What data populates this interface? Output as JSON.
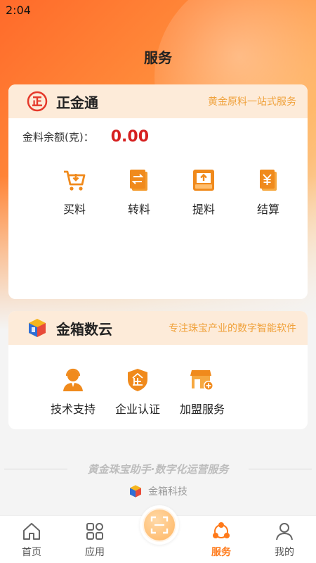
{
  "status_bar": {
    "time": "2:04"
  },
  "page": {
    "title": "服务"
  },
  "card_zhengjintong": {
    "name": "正金通",
    "subtitle": "黄金原料一站式服务",
    "balance_label": "金料余额(克)：",
    "balance_value": "0.00",
    "items": [
      {
        "label": "买料",
        "icon": "shopping-cart-icon"
      },
      {
        "label": "转料",
        "icon": "transfer-icon"
      },
      {
        "label": "提料",
        "icon": "inbox-tray-icon"
      },
      {
        "label": "结算",
        "icon": "yuan-bill-icon"
      }
    ]
  },
  "card_jinxiang": {
    "name": "金箱数云",
    "subtitle": "专注珠宝产业的数字智能软件",
    "items": [
      {
        "label": "技术支持",
        "icon": "support-agent-icon"
      },
      {
        "label": "企业认证",
        "icon": "enterprise-shield-icon"
      },
      {
        "label": "加盟服务",
        "icon": "storefront-add-icon"
      }
    ]
  },
  "footer": {
    "slogan": "黄金珠宝助手·数字化运营服务",
    "brand": "金箱科技"
  },
  "tabbar": {
    "items": [
      {
        "label": "首页",
        "icon": "home-icon"
      },
      {
        "label": "应用",
        "icon": "apps-grid-icon"
      },
      {
        "label": "",
        "icon": "scan-icon"
      },
      {
        "label": "服务",
        "icon": "service-nodes-icon",
        "active": true
      },
      {
        "label": "我的",
        "icon": "user-icon"
      }
    ]
  },
  "colors": {
    "accent": "#ff7a1a",
    "balance": "#d62020",
    "subtitle": "#f0a23c"
  }
}
